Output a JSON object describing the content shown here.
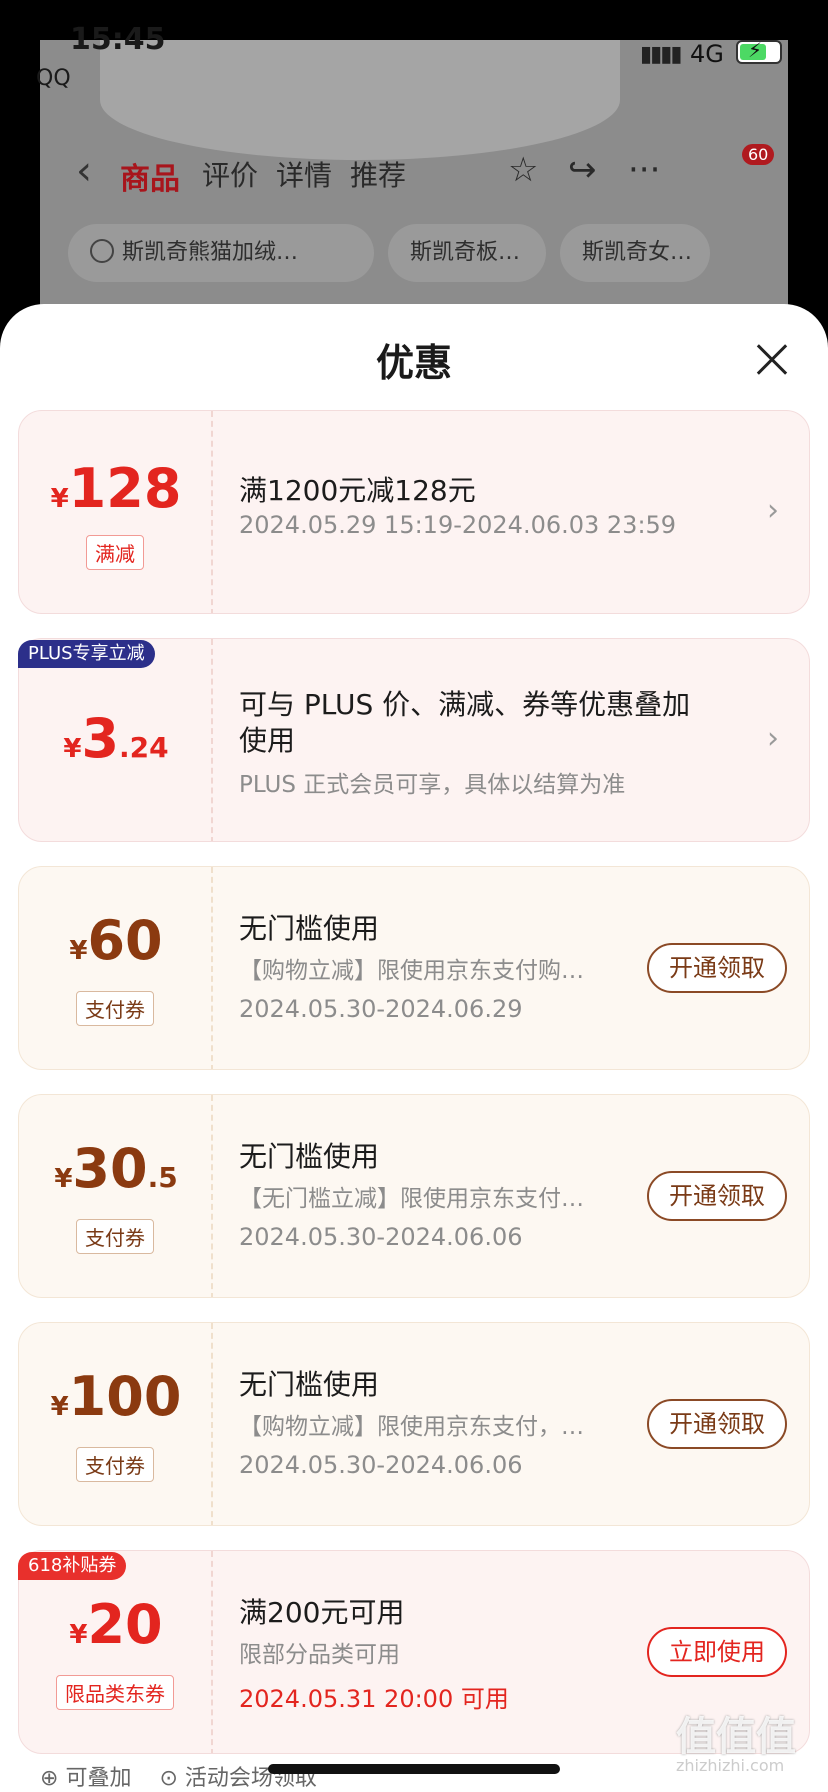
{
  "status_bar": {
    "time": "15:45",
    "back_app": "QQ",
    "network": "4G"
  },
  "nav": {
    "tabs": [
      "商品",
      "评价",
      "详情",
      "推荐"
    ],
    "active_tab": "商品",
    "more_badge": "60"
  },
  "search": {
    "query": "斯凯奇熊猫加绒…",
    "chips": [
      "斯凯奇板…",
      "斯凯奇女…"
    ]
  },
  "sheet": {
    "title": "优惠",
    "coupons": [
      {
        "currency": "¥",
        "amount": "128",
        "decimal": "",
        "tag": "满减",
        "title": "满1200元减128元",
        "subtitle": "",
        "date": "2024.05.29 15:19-2024.06.03 23:59",
        "ribbon": "",
        "action": ""
      },
      {
        "currency": "¥",
        "amount": "3",
        "decimal": ".24",
        "tag": "",
        "title": "可与 PLUS 价、满减、券等优惠叠加",
        "title2": "使用",
        "subtitle": "PLUS 正式会员可享，具体以结算为准",
        "date": "",
        "ribbon": "PLUS专享立减",
        "action": ""
      },
      {
        "currency": "¥",
        "amount": "60",
        "decimal": "",
        "tag": "支付券",
        "title": "无门槛使用",
        "subtitle": "【购物立减】限使用京东支付购…",
        "date": "2024.05.30-2024.06.29",
        "ribbon": "",
        "action": "开通领取"
      },
      {
        "currency": "¥",
        "amount": "30",
        "decimal": ".5",
        "tag": "支付券",
        "title": "无门槛使用",
        "subtitle": "【无门槛立减】限使用京东支付…",
        "date": "2024.05.30-2024.06.06",
        "ribbon": "",
        "action": "开通领取"
      },
      {
        "currency": "¥",
        "amount": "100",
        "decimal": "",
        "tag": "支付券",
        "title": "无门槛使用",
        "subtitle": "【购物立减】限使用京东支付，…",
        "date": "2024.05.30-2024.06.06",
        "ribbon": "",
        "action": "开通领取"
      },
      {
        "currency": "¥",
        "amount": "20",
        "decimal": "",
        "tag": "限品类东券",
        "title": "满200元可用",
        "subtitle": "限部分品类可用",
        "date": "2024.05.31 20:00 可用",
        "ribbon": "618补贴券",
        "action": "立即使用"
      }
    ],
    "footer_left": "可叠加",
    "footer_right": "活动会场领取"
  },
  "watermark": {
    "text": "值值值",
    "site": "zhizhizhi.com"
  },
  "colors": {
    "accent_red": "#e3251f",
    "gold_brown": "#8b3a10",
    "plus_blue": "#2c2f8a"
  }
}
